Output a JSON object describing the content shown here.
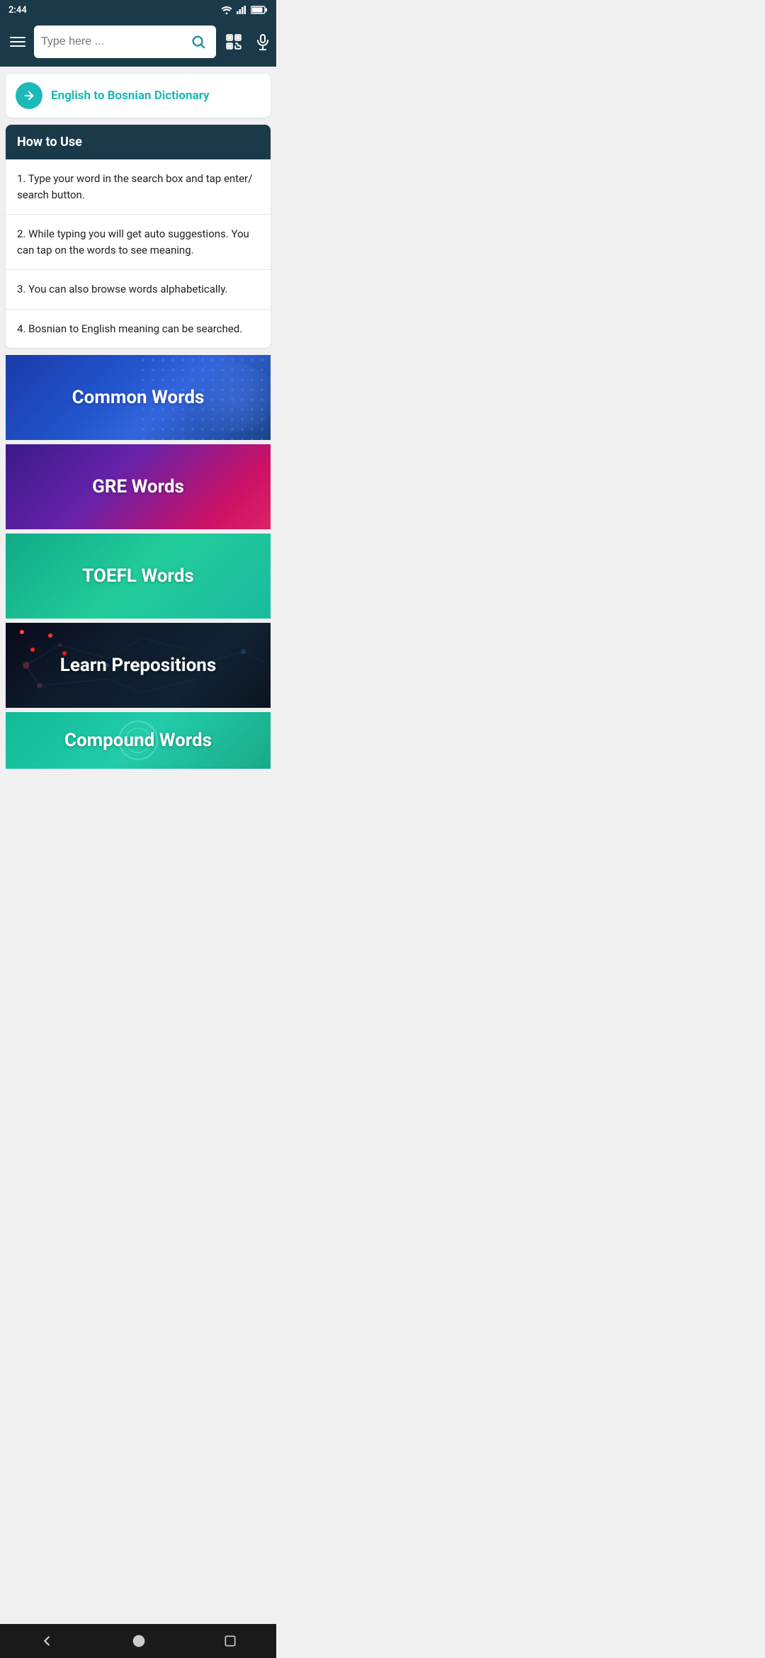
{
  "statusBar": {
    "time": "2:44",
    "icons": [
      "sim",
      "wifi",
      "battery"
    ]
  },
  "topBar": {
    "searchPlaceholder": "Type here ...",
    "menuLabel": "Menu"
  },
  "dictionaryHeader": {
    "title": "English to Bosnian Dictionary"
  },
  "howToUse": {
    "heading": "How to Use",
    "items": [
      "1. Type your word in the search box and tap enter/ search button.",
      "2. While typing you will get auto suggestions. You can tap on the words to see meaning.",
      "3. You can also browse words alphabetically.",
      "4. Bosnian to English meaning can be searched."
    ]
  },
  "banners": [
    {
      "label": "Common Words",
      "key": "common-words"
    },
    {
      "label": "GRE Words",
      "key": "gre-words"
    },
    {
      "label": "TOEFL Words",
      "key": "toefl-words"
    },
    {
      "label": "Learn Prepositions",
      "key": "learn-prepositions"
    },
    {
      "label": "Compound Words",
      "key": "compound-words"
    }
  ],
  "bottomNav": {
    "back": "◀",
    "home": "●",
    "recent": "■"
  }
}
